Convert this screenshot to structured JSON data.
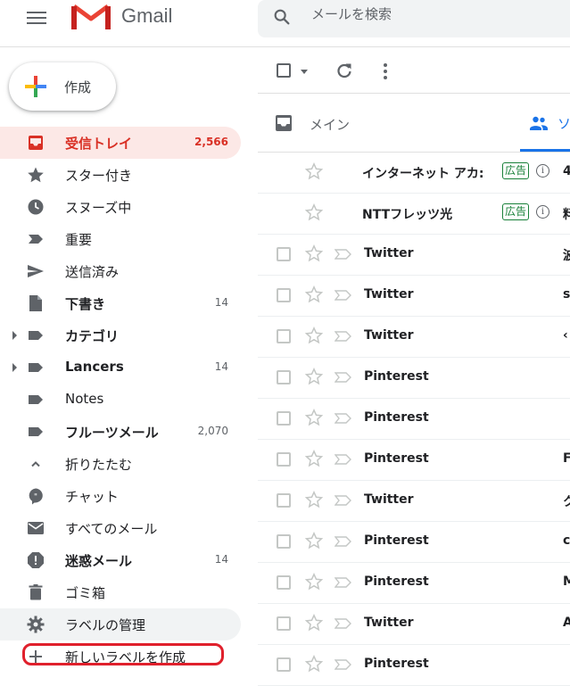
{
  "header": {
    "app_name": "Gmail",
    "search_placeholder": "メールを検索"
  },
  "compose": {
    "label": "作成"
  },
  "sidebar": {
    "items": [
      {
        "label": "受信トレイ",
        "count": "2,566",
        "icon": "inbox-icon",
        "active": true
      },
      {
        "label": "スター付き",
        "count": "",
        "icon": "star-icon"
      },
      {
        "label": "スヌーズ中",
        "count": "",
        "icon": "clock-icon"
      },
      {
        "label": "重要",
        "count": "",
        "icon": "important-icon"
      },
      {
        "label": "送信済み",
        "count": "",
        "icon": "send-icon"
      },
      {
        "label": "下書き",
        "count": "14",
        "icon": "draft-icon",
        "bold": true
      },
      {
        "label": "カテゴリ",
        "count": "",
        "icon": "label-icon",
        "bold": true,
        "expandable": true
      },
      {
        "label": "Lancers",
        "count": "14",
        "icon": "label-icon",
        "bold": true,
        "expandable": true
      },
      {
        "label": "Notes",
        "count": "",
        "icon": "label-icon"
      },
      {
        "label": "フルーツメール",
        "count": "2,070",
        "icon": "label-icon",
        "bold": true
      },
      {
        "label": "折りたたむ",
        "count": "",
        "icon": "chevron-up-icon"
      },
      {
        "label": "チャット",
        "count": "",
        "icon": "chat-icon"
      },
      {
        "label": "すべてのメール",
        "count": "",
        "icon": "mail-icon"
      },
      {
        "label": "迷惑メール",
        "count": "14",
        "icon": "spam-icon",
        "bold": true
      },
      {
        "label": "ゴミ箱",
        "count": "",
        "icon": "trash-icon"
      },
      {
        "label": "ラベルの管理",
        "count": "",
        "icon": "gear-icon"
      },
      {
        "label": "新しいラベルを作成",
        "count": "",
        "icon": "plus-icon"
      }
    ]
  },
  "tabs": {
    "main": "メイン",
    "social": "ソ"
  },
  "mails": [
    {
      "sender": "インターネット アカ:",
      "ad": true,
      "badge": "広告",
      "snippet": "4"
    },
    {
      "sender": "NTTフレッツ光",
      "ad": true,
      "badge": "広告",
      "snippet": "料"
    },
    {
      "sender": "Twitter",
      "snippet": "波"
    },
    {
      "sender": "Twitter",
      "snippet": "s"
    },
    {
      "sender": "Twitter",
      "snippet": "‹"
    },
    {
      "sender": "Pinterest",
      "snippet": ""
    },
    {
      "sender": "Pinterest",
      "snippet": ""
    },
    {
      "sender": "Pinterest",
      "snippet": "F"
    },
    {
      "sender": "Twitter",
      "snippet": "ク"
    },
    {
      "sender": "Pinterest",
      "snippet": "c"
    },
    {
      "sender": "Pinterest",
      "snippet": "M"
    },
    {
      "sender": "Twitter",
      "snippet": "A"
    },
    {
      "sender": "Pinterest",
      "snippet": ""
    }
  ],
  "colors": {
    "accent_red": "#d93025",
    "annotation_red": "#e0202c",
    "tab_blue": "#1a73e8",
    "ad_green": "#188038"
  }
}
